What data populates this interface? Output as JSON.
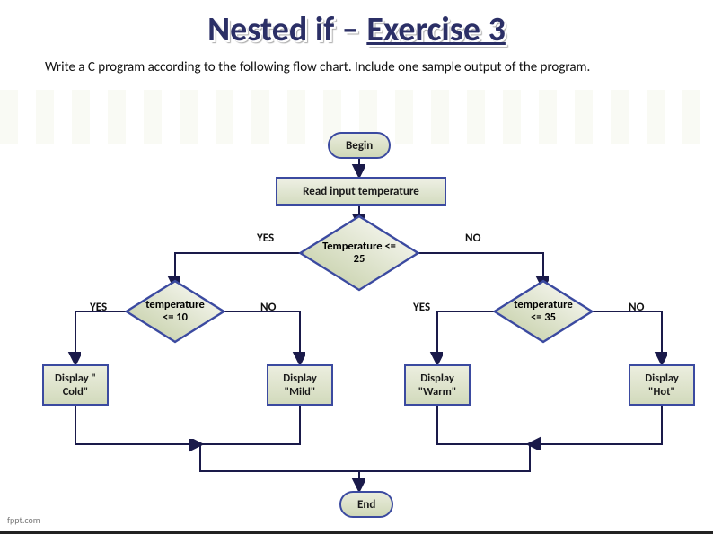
{
  "title_a": "Nested if – ",
  "title_b": "Exercise 3",
  "prompt": "Write a C program according to the following flow chart. Include one sample output of the program.",
  "nodes": {
    "begin": "Begin",
    "read": "Read input temperature",
    "d1": "Temperature <= 25",
    "d2": "temperature <= 10",
    "d3": "temperature <= 35",
    "cold": "Display \" Cold\"",
    "mild": "Display \"Mild\"",
    "warm": "Display \"Warm\"",
    "hot": "Display \"Hot\"",
    "end": "End"
  },
  "labels": {
    "yes": "YES",
    "no": "NO"
  },
  "footer": "fppt.com",
  "chart_data": {
    "type": "flowchart",
    "nodes": [
      {
        "id": "begin",
        "kind": "terminator",
        "text": "Begin"
      },
      {
        "id": "read",
        "kind": "process",
        "text": "Read input temperature"
      },
      {
        "id": "d1",
        "kind": "decision",
        "text": "Temperature <= 25"
      },
      {
        "id": "d2",
        "kind": "decision",
        "text": "temperature <= 10"
      },
      {
        "id": "d3",
        "kind": "decision",
        "text": "temperature <= 35"
      },
      {
        "id": "cold",
        "kind": "process",
        "text": "Display \" Cold\""
      },
      {
        "id": "mild",
        "kind": "process",
        "text": "Display \"Mild\""
      },
      {
        "id": "warm",
        "kind": "process",
        "text": "Display \"Warm\""
      },
      {
        "id": "hot",
        "kind": "process",
        "text": "Display \"Hot\""
      },
      {
        "id": "end",
        "kind": "terminator",
        "text": "End"
      }
    ],
    "edges": [
      {
        "from": "begin",
        "to": "read"
      },
      {
        "from": "read",
        "to": "d1"
      },
      {
        "from": "d1",
        "to": "d2",
        "label": "YES"
      },
      {
        "from": "d1",
        "to": "d3",
        "label": "NO"
      },
      {
        "from": "d2",
        "to": "cold",
        "label": "YES"
      },
      {
        "from": "d2",
        "to": "mild",
        "label": "NO"
      },
      {
        "from": "d3",
        "to": "warm",
        "label": "YES"
      },
      {
        "from": "d3",
        "to": "hot",
        "label": "NO"
      },
      {
        "from": "cold",
        "to": "end"
      },
      {
        "from": "mild",
        "to": "end"
      },
      {
        "from": "warm",
        "to": "end"
      },
      {
        "from": "hot",
        "to": "end"
      }
    ]
  }
}
